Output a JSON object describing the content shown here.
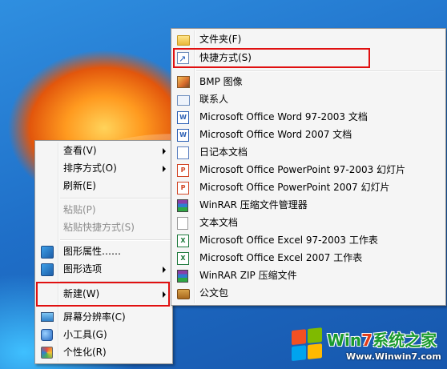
{
  "context_menu": {
    "items": [
      {
        "label": "查看(V)",
        "has_submenu": true,
        "icon": "",
        "disabled": false
      },
      {
        "label": "排序方式(O)",
        "has_submenu": true,
        "icon": "",
        "disabled": false
      },
      {
        "label": "刷新(E)",
        "has_submenu": false,
        "icon": "",
        "disabled": false
      },
      {
        "label": "粘贴(P)",
        "has_submenu": false,
        "icon": "",
        "disabled": true
      },
      {
        "label": "粘贴快捷方式(S)",
        "has_submenu": false,
        "icon": "",
        "disabled": true
      },
      {
        "label": "图形属性……",
        "has_submenu": false,
        "icon": "graphics-properties-icon",
        "disabled": false
      },
      {
        "label": "图形选项",
        "has_submenu": true,
        "icon": "graphics-options-icon",
        "disabled": false
      },
      {
        "label": "新建(W)",
        "has_submenu": true,
        "icon": "",
        "disabled": false,
        "highlighted": true
      },
      {
        "label": "屏幕分辨率(C)",
        "has_submenu": false,
        "icon": "monitor-icon",
        "disabled": false
      },
      {
        "label": "小工具(G)",
        "has_submenu": false,
        "icon": "gadgets-icon",
        "disabled": false
      },
      {
        "label": "个性化(R)",
        "has_submenu": false,
        "icon": "personalize-icon",
        "disabled": false
      }
    ]
  },
  "new_submenu": {
    "items": [
      {
        "label": "文件夹(F)",
        "icon": "folder-icon"
      },
      {
        "label": "快捷方式(S)",
        "icon": "shortcut-icon",
        "highlighted": true
      },
      {
        "label": "BMP 图像",
        "icon": "bmp-image-icon"
      },
      {
        "label": "联系人",
        "icon": "contact-icon"
      },
      {
        "label": "Microsoft Office Word 97-2003 文档",
        "icon": "word-doc-icon"
      },
      {
        "label": "Microsoft Office Word 2007 文档",
        "icon": "word-docx-icon"
      },
      {
        "label": "日记本文档",
        "icon": "journal-icon"
      },
      {
        "label": "Microsoft Office PowerPoint 97-2003 幻灯片",
        "icon": "powerpoint-ppt-icon"
      },
      {
        "label": "Microsoft Office PowerPoint 2007 幻灯片",
        "icon": "powerpoint-pptx-icon"
      },
      {
        "label": "WinRAR 压缩文件管理器",
        "icon": "winrar-icon"
      },
      {
        "label": "文本文档",
        "icon": "text-document-icon"
      },
      {
        "label": "Microsoft Office Excel 97-2003 工作表",
        "icon": "excel-xls-icon"
      },
      {
        "label": "Microsoft Office Excel 2007 工作表",
        "icon": "excel-xlsx-icon"
      },
      {
        "label": "WinRAR ZIP 压缩文件",
        "icon": "winrar-zip-icon"
      },
      {
        "label": "公文包",
        "icon": "briefcase-icon"
      }
    ]
  },
  "watermark": {
    "brand_prefix": "Win",
    "brand_seven": "7",
    "brand_suffix": "系统之家",
    "url": "Www.Winwin7.com"
  },
  "colors": {
    "highlight_box": "#e01010",
    "menu_background": "#f5f5f5"
  }
}
